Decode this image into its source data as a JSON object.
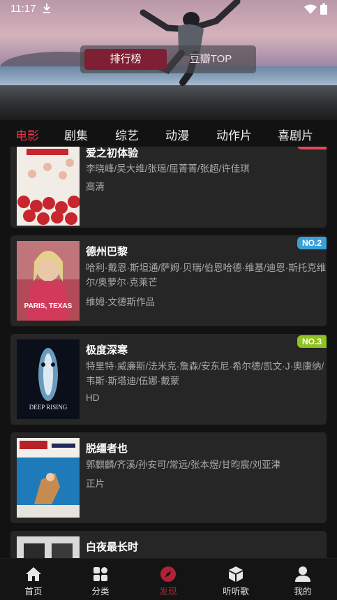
{
  "status_bar": {
    "time": "11:17"
  },
  "header": {
    "segments": [
      {
        "label": "排行榜",
        "active": true
      },
      {
        "label": "豆瓣TOP",
        "active": false
      }
    ]
  },
  "category_tabs": [
    {
      "label": "电影",
      "active": true
    },
    {
      "label": "剧集",
      "active": false
    },
    {
      "label": "综艺",
      "active": false
    },
    {
      "label": "动漫",
      "active": false
    },
    {
      "label": "动作片",
      "active": false
    },
    {
      "label": "喜剧片",
      "active": false
    }
  ],
  "movies": [
    {
      "title": "爱之初体验",
      "cast": "李晓峰/吴大维/张瑶/屈菁菁/张超/许佳琪",
      "tag": "高清",
      "rank": "",
      "rank_color": "#e8475a"
    },
    {
      "title": "德州巴黎",
      "cast": "哈利·戴恩·斯坦通/萨姆·贝瑞/伯恩哈德·维基/迪恩·斯托克维尔/奥萝尔·克莱芒",
      "tag": "维姆·文德斯作品",
      "rank": "NO.2",
      "rank_color": "#3aa0d8",
      "poster_text": "PARIS, TEXAS"
    },
    {
      "title": "极度深寒",
      "cast": "特里特·威廉斯/法米克·詹森/安东尼·希尔德/凯文·J·奥康纳/韦斯·斯塔迪/伍娜·戴蒙",
      "tag": "HD",
      "rank": "NO.3",
      "rank_color": "#8fc31f",
      "poster_text": "DEEP RISING"
    },
    {
      "title": "脱缰者也",
      "cast": "郭麒麟/齐溪/孙安可/常远/张本煜/甘昀宸/刘亚津",
      "tag": "正片",
      "rank": "",
      "rank_color": ""
    },
    {
      "title": "白夜最长时",
      "cast": "",
      "tag": "",
      "rank": "",
      "rank_color": ""
    }
  ],
  "bottom_nav": [
    {
      "label": "首页",
      "icon": "home-icon",
      "active": false
    },
    {
      "label": "分类",
      "icon": "grid-icon",
      "active": false
    },
    {
      "label": "发现",
      "icon": "compass-icon",
      "active": true
    },
    {
      "label": "听听歌",
      "icon": "cube-icon",
      "active": false
    },
    {
      "label": "我的",
      "icon": "user-icon",
      "active": false
    }
  ],
  "colors": {
    "accent": "#e2334a",
    "card_bg": "#262626",
    "page_bg": "#121212",
    "segment_active": "#7f1f33"
  }
}
